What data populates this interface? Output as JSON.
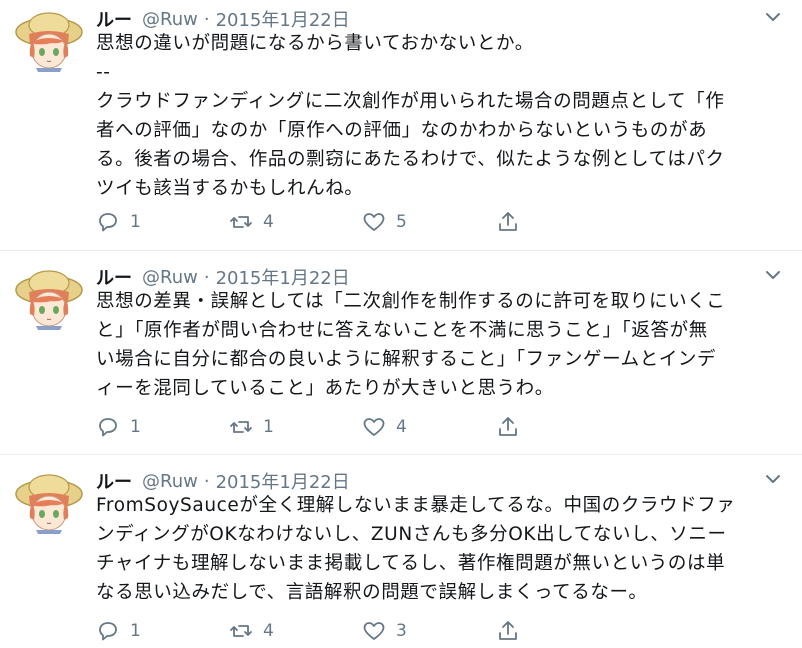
{
  "tweets": [
    {
      "name": "ルー",
      "handle": "@Ruw",
      "separator": "·",
      "date": "2015年1月22日",
      "lines": [
        "思想の違いが問題になるから書いておかないとか。",
        "--",
        "クラウドファンディングに二次創作が用いられた場合の問題点として「作",
        "者への評価」なのか「原作への評価」なのかわからないというものがあ",
        "る。後者の場合、作品の剽窃にあたるわけで、似たような例としてはパク",
        "ツイも該当するかもしれんね。"
      ],
      "replies": "1",
      "retweets": "4",
      "likes": "5",
      "icons": [
        "reply-icon",
        "retweet-icon",
        "like-icon",
        "share-icon",
        "chevron-down-icon"
      ]
    },
    {
      "name": "ルー",
      "handle": "@Ruw",
      "separator": "·",
      "date": "2015年1月22日",
      "lines": [
        "思想の差異・誤解としては「二次創作を制作するのに許可を取りにいくこ",
        "と」「原作者が問い合わせに答えないことを不満に思うこと」「返答が無",
        "い場合に自分に都合の良いように解釈すること」「ファンゲームとインデ",
        "ィーを混同していること」あたりが大きいと思うわ。"
      ],
      "replies": "1",
      "retweets": "1",
      "likes": "4",
      "icons": [
        "reply-icon",
        "retweet-icon",
        "like-icon",
        "share-icon",
        "chevron-down-icon"
      ]
    },
    {
      "name": "ルー",
      "handle": "@Ruw",
      "separator": "·",
      "date": "2015年1月22日",
      "lines": [
        "FromSoySauceが全く理解しないまま暴走してるな。中国のクラウドファ",
        "ンディングがOKなわけないし、ZUNさんも多分OK出してないし、ソニー",
        "チャイナも理解しないまま掲載してるし、著作権問題が無いというのは単",
        "なる思い込みだしで、言語解釈の問題で誤解しまくってるなー。"
      ],
      "replies": "1",
      "retweets": "4",
      "likes": "3",
      "icons": [
        "reply-icon",
        "retweet-icon",
        "like-icon",
        "share-icon",
        "chevron-down-icon"
      ]
    }
  ],
  "colors": {
    "text": "#14171a",
    "muted": "#657786",
    "divider": "#e6ecf0",
    "background": "#ffffff"
  }
}
